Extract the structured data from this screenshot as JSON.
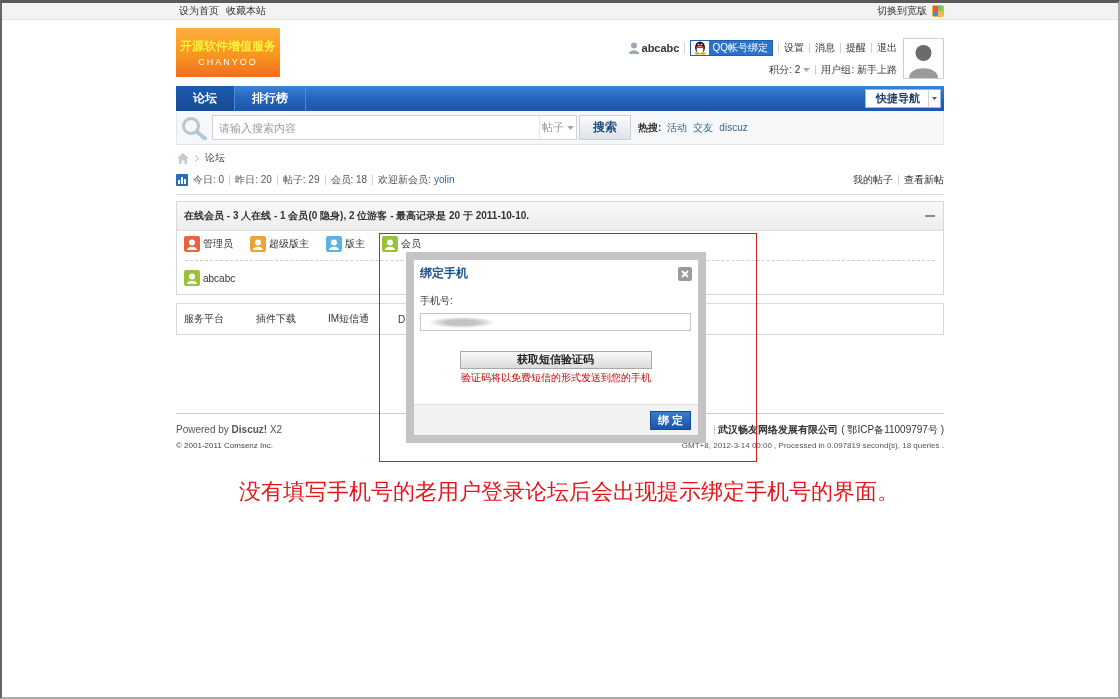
{
  "topbar": {
    "links": [
      "设为首页",
      "收藏本站"
    ],
    "switch_label": "切换到宽版"
  },
  "header": {
    "logo": {
      "title": "开源软件增值服务",
      "subtitle": "CHANYOO"
    },
    "user": {
      "name": "abcabc",
      "qq_button": "QQ帐号绑定",
      "links": [
        "设置",
        "消息",
        "提醒",
        "退出"
      ],
      "credits": "积分: 2",
      "group": "用户组: 新手上路"
    }
  },
  "nav": {
    "tabs": [
      {
        "label": "论坛",
        "selected": true
      },
      {
        "label": "排行榜",
        "selected": false
      }
    ],
    "quick_nav": "快捷导航"
  },
  "search": {
    "placeholder": "请输入搜索内容",
    "scope": "帖子",
    "button": "搜索",
    "hot_label": "热搜:",
    "hot_terms": [
      "活动",
      "交友",
      "discuz"
    ]
  },
  "breadcrumb": [
    "论坛"
  ],
  "stats": {
    "items": [
      "今日: 0",
      "昨日: 20",
      "帖子: 29",
      "会员: 18"
    ],
    "newest_label": "欢迎新会员:",
    "newest_member": "yolin",
    "links": [
      "我的帖子",
      "查看新帖"
    ]
  },
  "online": {
    "title": "在线会员 - 3 人在线 - 1 会员(0 隐身), 2 位游客 - 最高记录是 20 于 2011-10-10.",
    "expanded": true,
    "legend": [
      {
        "label": "管理员",
        "color": "#e8643c"
      },
      {
        "label": "超级版主",
        "color": "#eaa23a"
      },
      {
        "label": "版主",
        "color": "#5ab3e0"
      },
      {
        "label": "会员",
        "color": "#98c23c"
      }
    ],
    "members": [
      {
        "name": "abcabc",
        "color": "#98c23c"
      }
    ]
  },
  "service_links": [
    "服务平台",
    "插件下载",
    "IM短信通",
    "D"
  ],
  "footer": {
    "powered": "Powered by **Discuz!** X2",
    "copyright": "© 2001-2011 Comsenz Inc.",
    "company": "武汉畅友网络发展有限公司",
    "icp": "( 鄂ICP备11009797号 )",
    "stats": "GMT+8, 2012-3-14 00:00 , Processed in 0.097819 second(s), 18 queries ."
  },
  "dialog": {
    "title": "绑定手机",
    "phone_label": "手机号:",
    "phone_value_blurred": true,
    "sms_button": "获取短信验证码",
    "sms_note": "验证码将以免费短信的形式发送到您的手机",
    "submit": "绑 定"
  },
  "annotation": {
    "caption": "没有填写手机号的老用户登录论坛后会出现提示绑定手机号的界面。"
  }
}
